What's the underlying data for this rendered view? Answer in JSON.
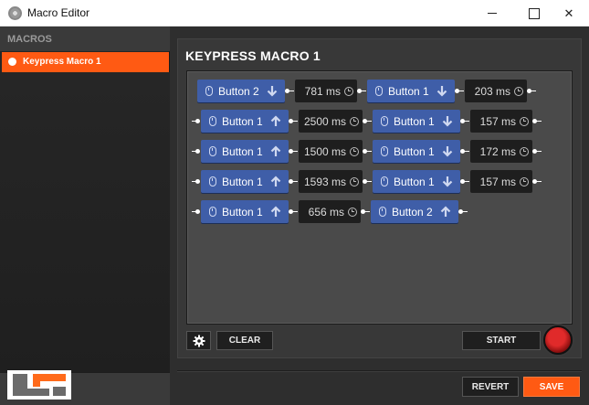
{
  "window": {
    "title": "Macro Editor",
    "minimize_icon": "minimize-icon",
    "maximize_icon": "maximize-icon",
    "close_glyph": "✕"
  },
  "sidebar": {
    "title": "MACROS",
    "items": [
      {
        "label": "Keypress Macro 1",
        "selected": true
      }
    ]
  },
  "editor": {
    "title": "KEYPRESS MACRO 1",
    "rows": [
      [
        {
          "kind": "button",
          "label": "Button 2",
          "dir": "down"
        },
        {
          "kind": "delay",
          "label": "781 ms"
        },
        {
          "kind": "button",
          "label": "Button 1",
          "dir": "down"
        },
        {
          "kind": "delay",
          "label": "203 ms"
        }
      ],
      [
        {
          "kind": "button",
          "label": "Button 1",
          "dir": "up"
        },
        {
          "kind": "delay",
          "label": "2500 ms"
        },
        {
          "kind": "button",
          "label": "Button 1",
          "dir": "down"
        },
        {
          "kind": "delay",
          "label": "157 ms"
        }
      ],
      [
        {
          "kind": "button",
          "label": "Button 1",
          "dir": "up"
        },
        {
          "kind": "delay",
          "label": "1500 ms"
        },
        {
          "kind": "button",
          "label": "Button 1",
          "dir": "down"
        },
        {
          "kind": "delay",
          "label": "172 ms"
        }
      ],
      [
        {
          "kind": "button",
          "label": "Button 1",
          "dir": "up"
        },
        {
          "kind": "delay",
          "label": "1593 ms"
        },
        {
          "kind": "button",
          "label": "Button 1",
          "dir": "down"
        },
        {
          "kind": "delay",
          "label": "157 ms"
        }
      ],
      [
        {
          "kind": "button",
          "label": "Button 1",
          "dir": "up"
        },
        {
          "kind": "delay",
          "label": "656 ms"
        },
        {
          "kind": "button",
          "label": "Button 2",
          "dir": "up"
        }
      ]
    ],
    "controls": {
      "settings_icon": "gear-icon",
      "clear_label": "CLEAR",
      "start_label": "START",
      "record_icon": "record-icon"
    }
  },
  "footer": {
    "revert_label": "REVERT",
    "save_label": "SAVE"
  },
  "colors": {
    "accent": "#ff5a13",
    "button_node": "#3f5ea8",
    "delay_node": "#1e1e1e",
    "background": "#2e2e2e"
  }
}
